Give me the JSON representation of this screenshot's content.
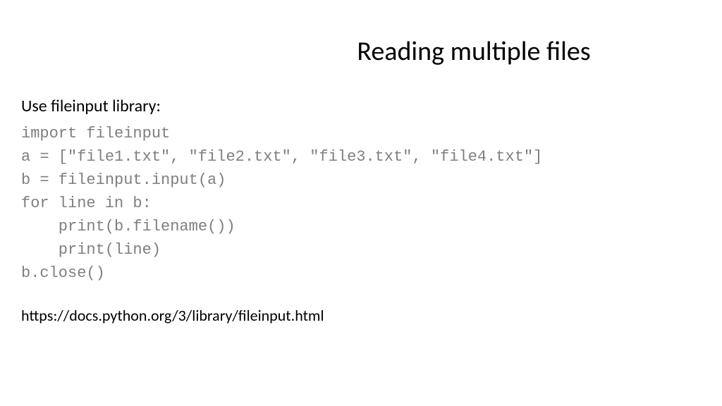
{
  "slide": {
    "title": "Reading multiple files",
    "subtitle": "Use fileinput library:",
    "code_lines": {
      "l1": "import fileinput",
      "l2": "a = [\"file1.txt\", \"file2.txt\", \"file3.txt\", \"file4.txt\"]",
      "l3": "b = fileinput.input(a)",
      "l4": "for line in b:",
      "l5": "    print(b.filename())",
      "l6": "    print(line)",
      "l7": "b.close()"
    },
    "footer_link": "https://docs.python.org/3/library/fileinput.html"
  }
}
